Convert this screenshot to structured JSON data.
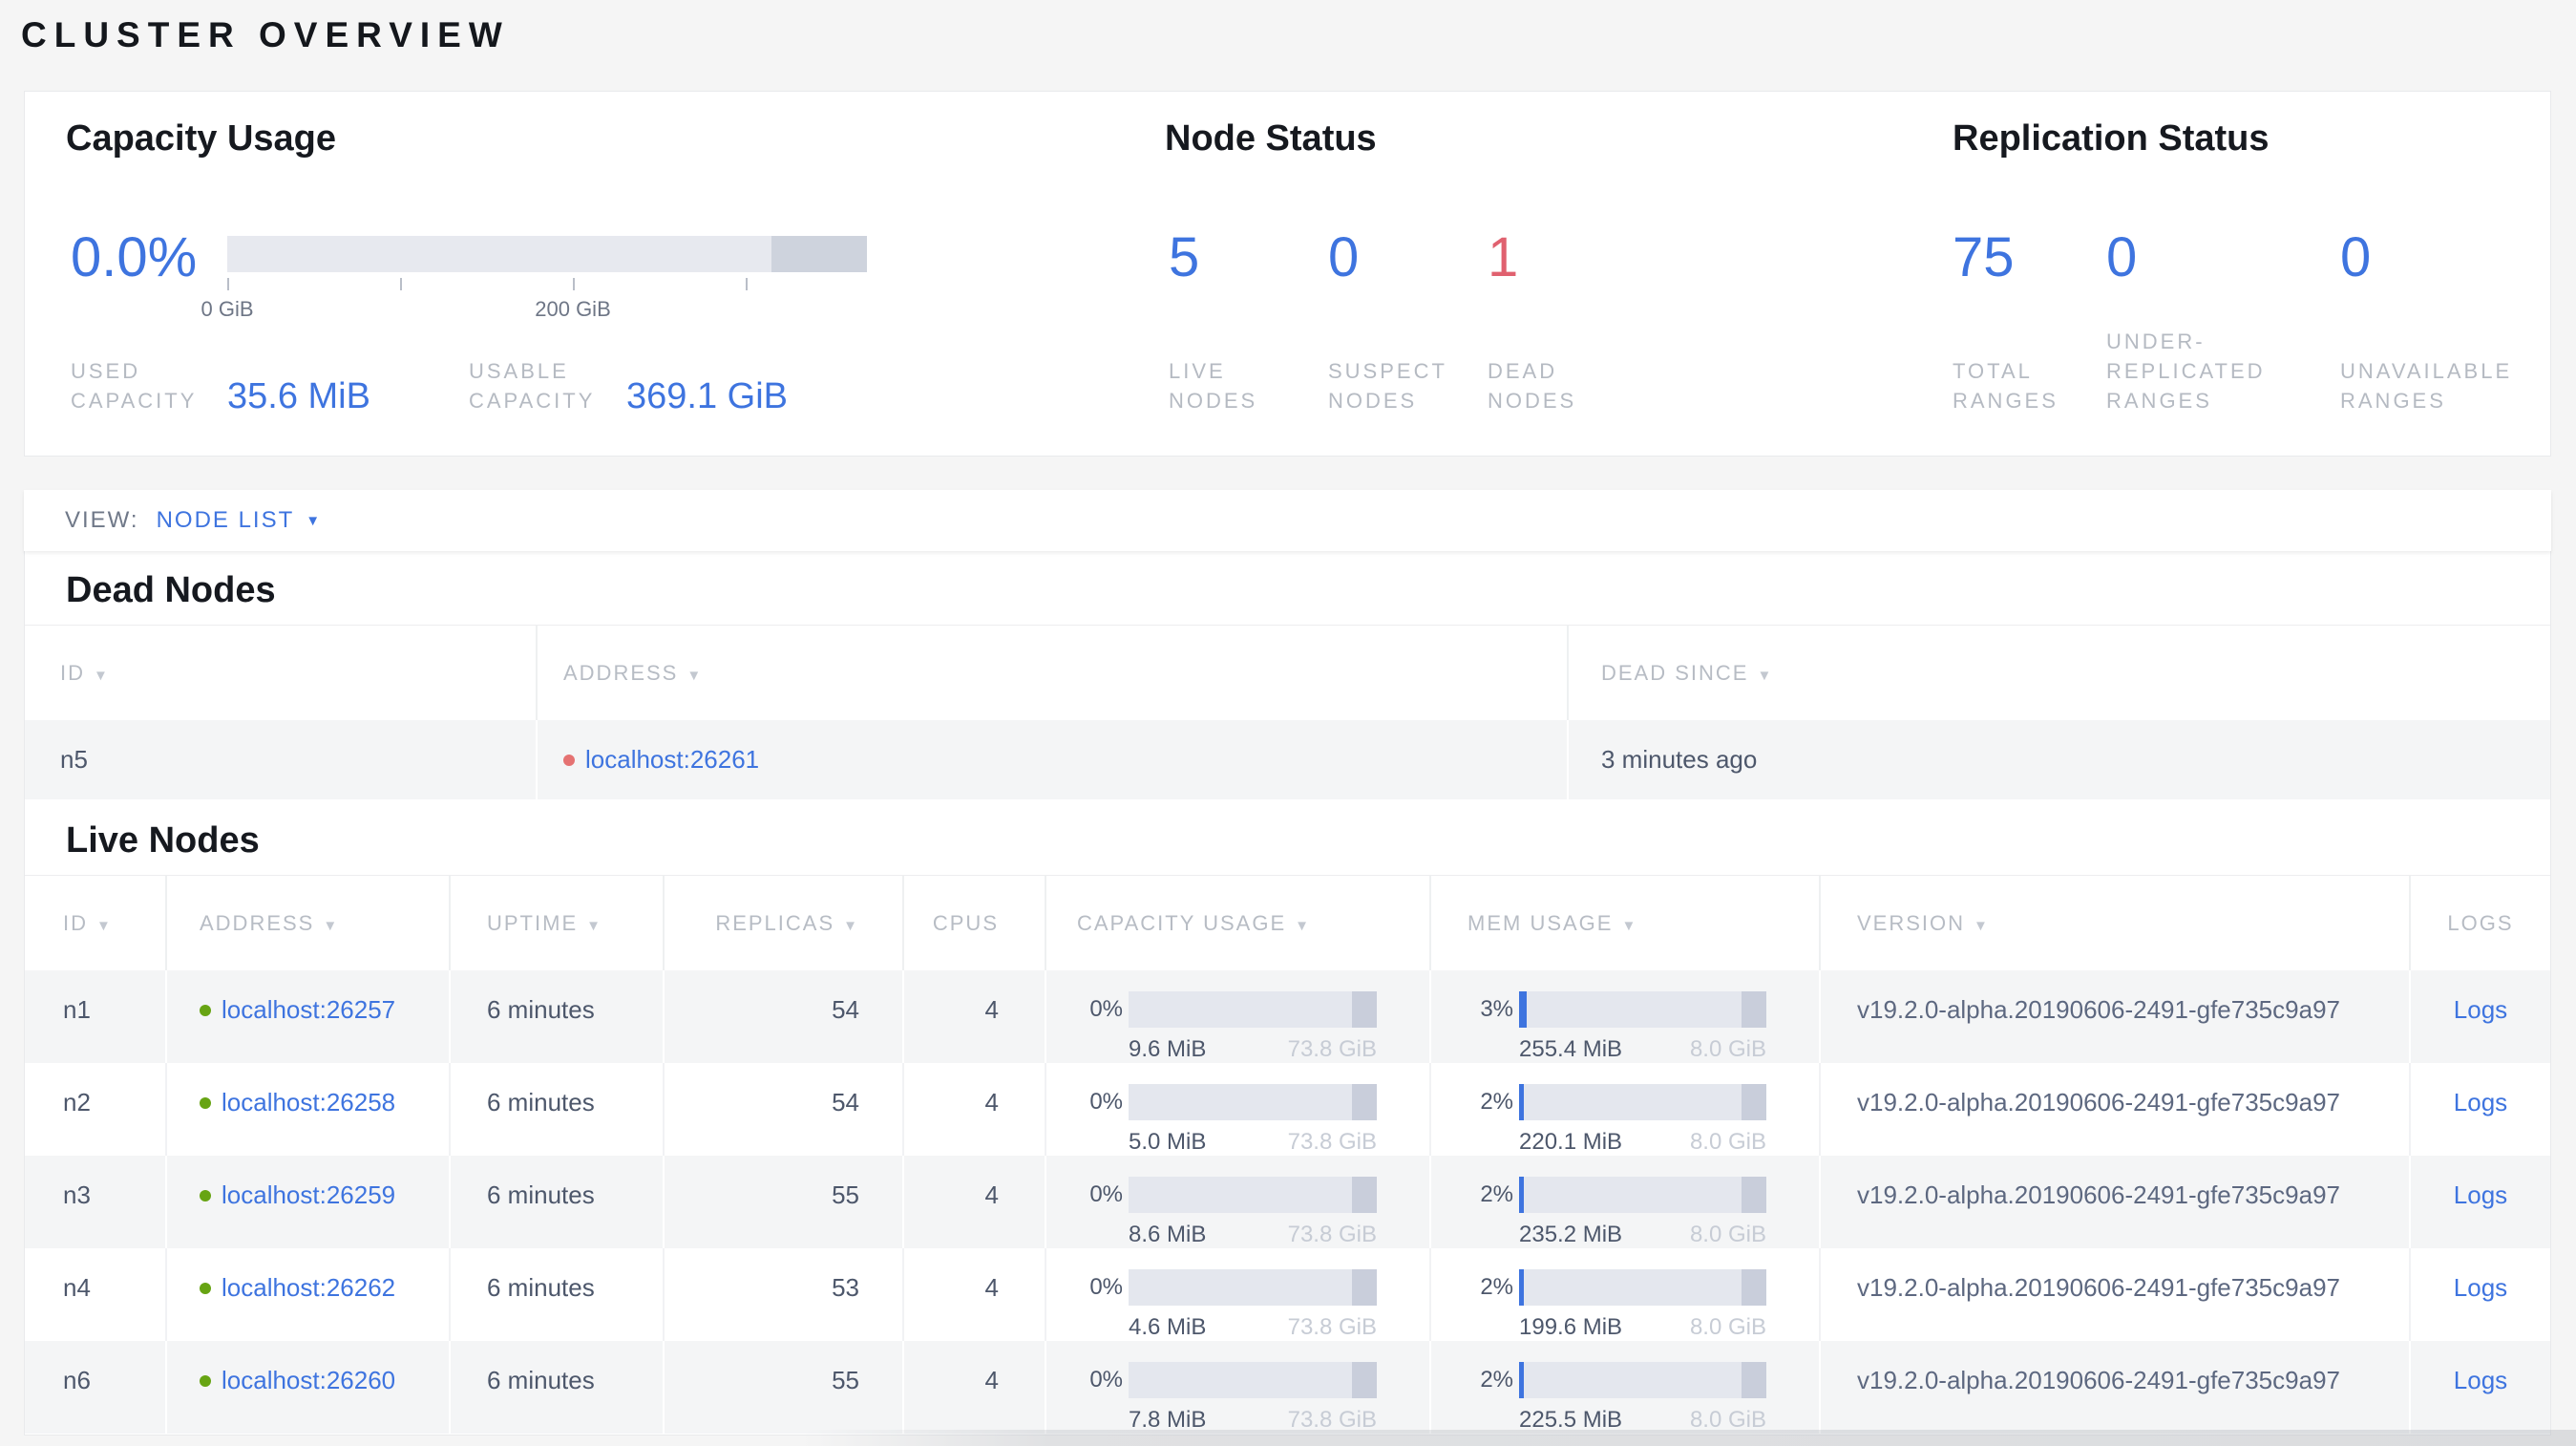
{
  "colors": {
    "blue": "#3e74df",
    "red": "#e0616f",
    "green": "#67a413"
  },
  "icons": {
    "sort_arrow": "▼",
    "dropdown_arrow": "▼"
  },
  "page": {
    "title": "CLUSTER OVERVIEW"
  },
  "overview": {
    "capacity": {
      "title": "Capacity Usage",
      "percent": "0.0%",
      "fill_pct": 0,
      "tick_labels": [
        "0 GiB",
        "200 GiB"
      ],
      "used_label": "USED\nCAPACITY",
      "used_value": "35.6 MiB",
      "usable_label": "USABLE\nCAPACITY",
      "usable_value": "369.1 GiB"
    },
    "node_status": {
      "title": "Node Status",
      "stats": [
        {
          "value": "5",
          "label": "LIVE\nNODES"
        },
        {
          "value": "0",
          "label": "SUSPECT\nNODES"
        },
        {
          "value": "1",
          "label": "DEAD\nNODES"
        }
      ]
    },
    "replication": {
      "title": "Replication Status",
      "stats": [
        {
          "value": "75",
          "label": "TOTAL\nRANGES"
        },
        {
          "value": "0",
          "label": "UNDER-\nREPLICATED\nRANGES"
        },
        {
          "value": "0",
          "label": "UNAVAILABLE\nRANGES"
        }
      ]
    }
  },
  "view_bar": {
    "label": "VIEW:",
    "selected": "NODE LIST"
  },
  "dead_nodes": {
    "title": "Dead Nodes",
    "columns": [
      {
        "label": "ID"
      },
      {
        "label": "ADDRESS"
      },
      {
        "label": "DEAD SINCE"
      }
    ],
    "rows": [
      {
        "id": "n5",
        "address": "localhost:26261",
        "dead_since": "3 minutes ago"
      }
    ]
  },
  "live_nodes": {
    "title": "Live Nodes",
    "columns": [
      {
        "label": "ID"
      },
      {
        "label": "ADDRESS"
      },
      {
        "label": "UPTIME"
      },
      {
        "label": "REPLICAS"
      },
      {
        "label": "CPUS"
      },
      {
        "label": "CAPACITY USAGE"
      },
      {
        "label": "MEM USAGE"
      },
      {
        "label": "VERSION"
      },
      {
        "label": "LOGS"
      }
    ],
    "rows": [
      {
        "id": "n1",
        "address": "localhost:26257",
        "uptime": "6 minutes",
        "replicas": "54",
        "cpus": "4",
        "capacity": {
          "percent": "0%",
          "used": "9.6 MiB",
          "total": "73.8 GiB",
          "fill_pct": 0
        },
        "mem": {
          "percent": "3%",
          "used": "255.4 MiB",
          "total": "8.0 GiB",
          "fill_pct": 3
        },
        "version": "v19.2.0-alpha.20190606-2491-gfe735c9a97",
        "logs": "Logs"
      },
      {
        "id": "n2",
        "address": "localhost:26258",
        "uptime": "6 minutes",
        "replicas": "54",
        "cpus": "4",
        "capacity": {
          "percent": "0%",
          "used": "5.0 MiB",
          "total": "73.8 GiB",
          "fill_pct": 0
        },
        "mem": {
          "percent": "2%",
          "used": "220.1 MiB",
          "total": "8.0 GiB",
          "fill_pct": 2
        },
        "version": "v19.2.0-alpha.20190606-2491-gfe735c9a97",
        "logs": "Logs"
      },
      {
        "id": "n3",
        "address": "localhost:26259",
        "uptime": "6 minutes",
        "replicas": "55",
        "cpus": "4",
        "capacity": {
          "percent": "0%",
          "used": "8.6 MiB",
          "total": "73.8 GiB",
          "fill_pct": 0
        },
        "mem": {
          "percent": "2%",
          "used": "235.2 MiB",
          "total": "8.0 GiB",
          "fill_pct": 2
        },
        "version": "v19.2.0-alpha.20190606-2491-gfe735c9a97",
        "logs": "Logs"
      },
      {
        "id": "n4",
        "address": "localhost:26262",
        "uptime": "6 minutes",
        "replicas": "53",
        "cpus": "4",
        "capacity": {
          "percent": "0%",
          "used": "4.6 MiB",
          "total": "73.8 GiB",
          "fill_pct": 0
        },
        "mem": {
          "percent": "2%",
          "used": "199.6 MiB",
          "total": "8.0 GiB",
          "fill_pct": 2
        },
        "version": "v19.2.0-alpha.20190606-2491-gfe735c9a97",
        "logs": "Logs"
      },
      {
        "id": "n6",
        "address": "localhost:26260",
        "uptime": "6 minutes",
        "replicas": "55",
        "cpus": "4",
        "capacity": {
          "percent": "0%",
          "used": "7.8 MiB",
          "total": "73.8 GiB",
          "fill_pct": 0
        },
        "mem": {
          "percent": "2%",
          "used": "225.5 MiB",
          "total": "8.0 GiB",
          "fill_pct": 2
        },
        "version": "v19.2.0-alpha.20190606-2491-gfe735c9a97",
        "logs": "Logs"
      }
    ]
  }
}
